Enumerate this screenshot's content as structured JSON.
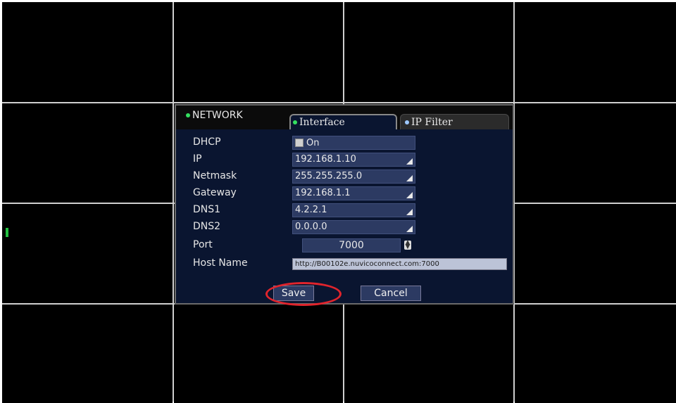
{
  "dialog": {
    "title": "NETWORK",
    "tabs": [
      {
        "label": "Interface",
        "active": true
      },
      {
        "label": "IP Filter",
        "active": false
      }
    ],
    "fields": {
      "dhcp": {
        "label": "DHCP",
        "value": "On",
        "checked": false
      },
      "ip": {
        "label": "IP",
        "value": "192.168.1.10"
      },
      "netmask": {
        "label": "Netmask",
        "value": "255.255.255.0"
      },
      "gateway": {
        "label": "Gateway",
        "value": "192.168.1.1"
      },
      "dns1": {
        "label": "DNS1",
        "value": "4.2.2.1"
      },
      "dns2": {
        "label": "DNS2",
        "value": "0.0.0.0"
      },
      "port": {
        "label": "Port",
        "value": "7000"
      },
      "host_name": {
        "label": "Host Name",
        "value": "http://B00102e.nuvicoconnect.com:7000"
      }
    },
    "buttons": {
      "save": "Save",
      "cancel": "Cancel"
    }
  },
  "colors": {
    "background": "#000000",
    "dialog_bg": "#0a1530",
    "field_bg": "#2c3a62",
    "highlight": "#e0242c",
    "indicator_green": "#34e060"
  }
}
